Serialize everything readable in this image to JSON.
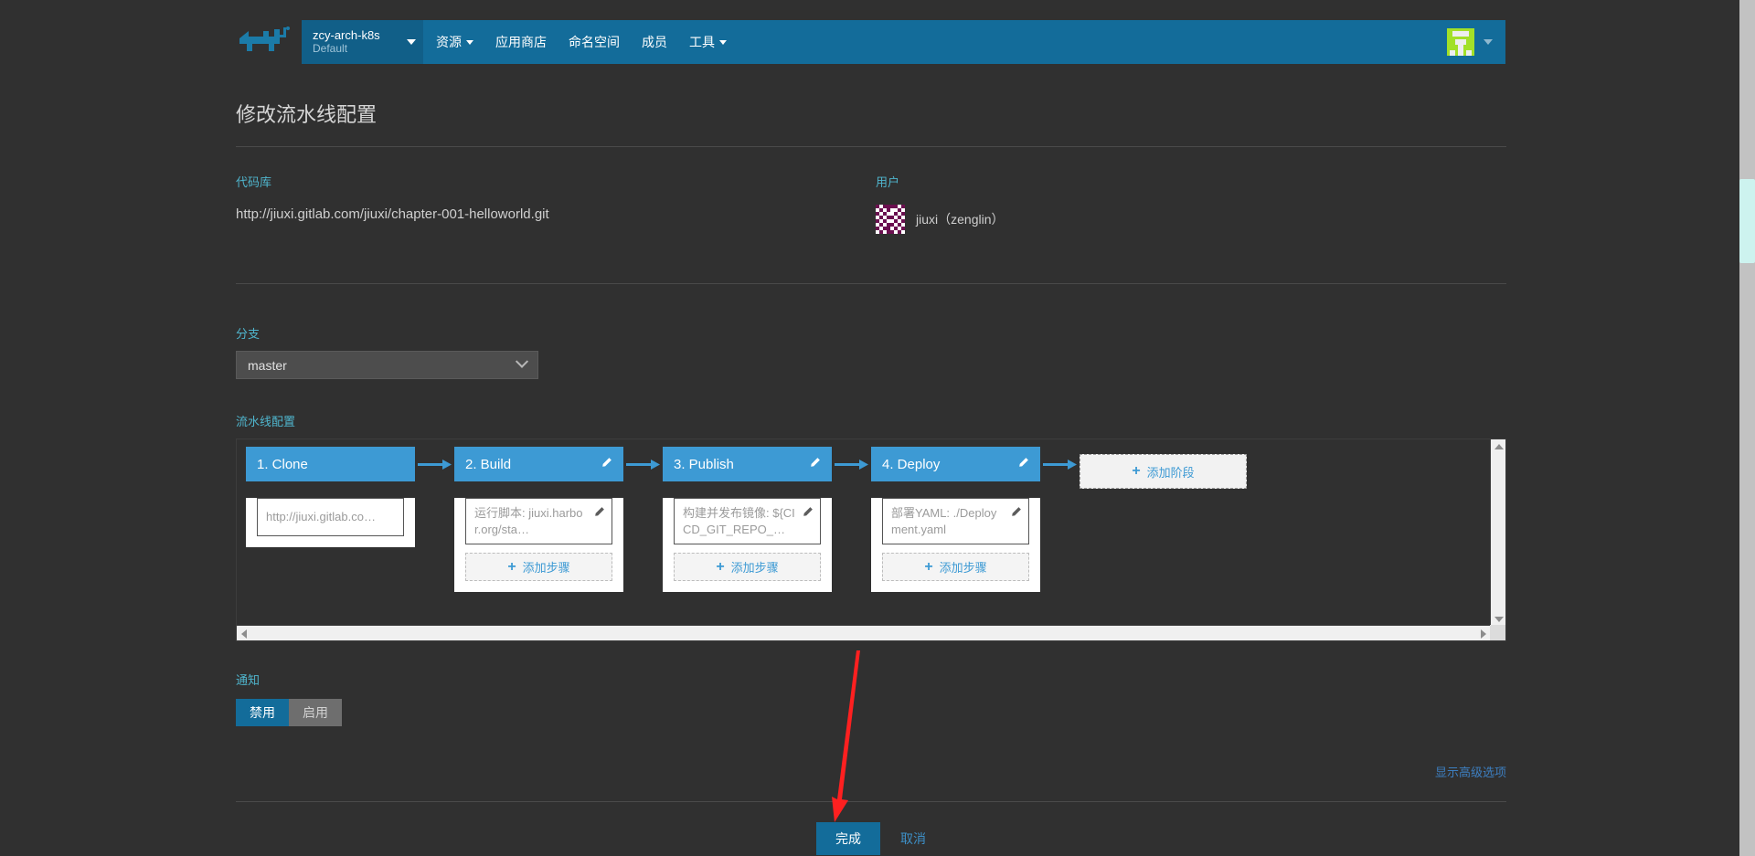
{
  "header": {
    "logo_icon": "rancher-cow-logo",
    "cluster": {
      "name": "zcy-arch-k8s",
      "sub": "Default"
    },
    "nav": [
      {
        "label": "资源",
        "has_caret": true
      },
      {
        "label": "应用商店",
        "has_caret": false
      },
      {
        "label": "命名空间",
        "has_caret": false
      },
      {
        "label": "成员",
        "has_caret": false
      },
      {
        "label": "工具",
        "has_caret": true
      }
    ],
    "avatar_icon": "user-avatar-identicon",
    "avatar_caret_icon": "chevron-down-icon"
  },
  "page": {
    "title": "修改流水线配置",
    "repo_label": "代码库",
    "repo_url": "http://jiuxi.gitlab.com/jiuxi/chapter-001-helloworld.git",
    "user_label": "用户",
    "user_name": "jiuxi（zenglin）",
    "user_identicon": "user-identicon",
    "branch_label": "分支",
    "branch_value": "master",
    "pipeline_label": "流水线配置",
    "notify_label": "通知",
    "notify_options": [
      {
        "label": "禁用",
        "active": true
      },
      {
        "label": "启用",
        "active": false
      }
    ],
    "advanced_link": "显示高级选项",
    "finish_button": "完成",
    "cancel_button": "取消"
  },
  "pipeline": {
    "add_stage_label": "添加阶段",
    "add_step_label": "添加步骤",
    "stages": [
      {
        "title": "1. Clone",
        "editable": false,
        "steps": [
          {
            "text": "http://jiuxi.gitlab.co…",
            "has_pencil": false
          }
        ],
        "has_add_step": false
      },
      {
        "title": "2. Build",
        "editable": true,
        "steps": [
          {
            "text": "运行脚本: jiuxi.harbor.org/sta…",
            "has_pencil": true
          }
        ],
        "has_add_step": true
      },
      {
        "title": "3. Publish",
        "editable": true,
        "steps": [
          {
            "text": "构建并发布镜像: ${CICD_GIT_REPO_…",
            "has_pencil": true
          }
        ],
        "has_add_step": true
      },
      {
        "title": "4. Deploy",
        "editable": true,
        "steps": [
          {
            "text": "部署YAML: ./Deployment.yaml",
            "has_pencil": true
          }
        ],
        "has_add_step": true
      }
    ]
  },
  "colors": {
    "page_bg": "#303030",
    "header_blue": "#136c9a",
    "stage_blue": "#3d9ad4",
    "accent_link": "#4fb5cd",
    "annotation_red": "#fe2020"
  }
}
